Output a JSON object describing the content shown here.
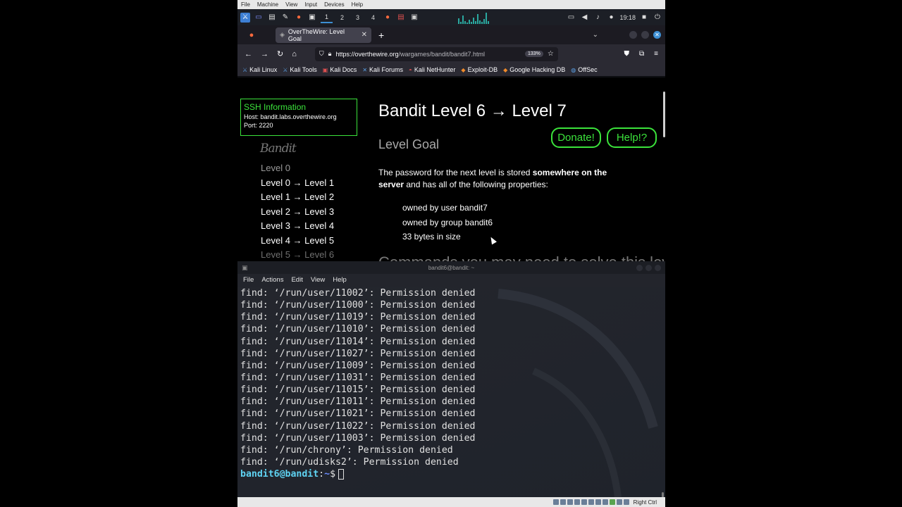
{
  "vbox_menu": [
    "File",
    "Machine",
    "View",
    "Input",
    "Devices",
    "Help"
  ],
  "panel": {
    "workspaces": [
      "1",
      "2",
      "3",
      "4"
    ],
    "clock": "19:18"
  },
  "browser": {
    "tab_title": "OverTheWire: Level Goal",
    "url_host": "https://overthewire.org",
    "url_path": "/wargames/bandit/bandit7.html",
    "zoom": "133%",
    "bookmarks": [
      "Kali Linux",
      "Kali Tools",
      "Kali Docs",
      "Kali Forums",
      "Kali NetHunter",
      "Exploit-DB",
      "Google Hacking DB",
      "OffSec"
    ]
  },
  "page": {
    "ssh_title": "SSH Information",
    "ssh_host": "Host: bandit.labs.overthewire.org",
    "ssh_port": "Port: 2220",
    "logo_text": "Bandit",
    "levels": [
      "Level 0",
      "Level 0 → Level 1",
      "Level 1 → Level 2",
      "Level 2 → Level 3",
      "Level 3 → Level 4",
      "Level 4 → Level 5",
      "Level 5 → Level 6"
    ],
    "title": "Bandit Level 6 → Level 7",
    "donate_label": "Donate!",
    "help_label": "Help!?",
    "level_goal_heading": "Level Goal",
    "goal_intro": "The password for the next level is stored ",
    "goal_bold": "somewhere on the server",
    "goal_rest": " and has all of the following properties:",
    "properties": [
      "owned by user bandit7",
      "owned by group bandit6",
      "33 bytes in size"
    ],
    "next_heading_partial": "Commands you may need to solve this level"
  },
  "terminal": {
    "title": "bandit6@bandit: ~",
    "menu": [
      "File",
      "Actions",
      "Edit",
      "View",
      "Help"
    ],
    "lines": [
      "find: ‘/run/user/11002’: Permission denied",
      "find: ‘/run/user/11000’: Permission denied",
      "find: ‘/run/user/11019’: Permission denied",
      "find: ‘/run/user/11010’: Permission denied",
      "find: ‘/run/user/11014’: Permission denied",
      "find: ‘/run/user/11027’: Permission denied",
      "find: ‘/run/user/11009’: Permission denied",
      "find: ‘/run/user/11031’: Permission denied",
      "find: ‘/run/user/11015’: Permission denied",
      "find: ‘/run/user/11011’: Permission denied",
      "find: ‘/run/user/11021’: Permission denied",
      "find: ‘/run/user/11022’: Permission denied",
      "find: ‘/run/user/11003’: Permission denied",
      "find: ‘/run/chrony’: Permission denied",
      "find: ‘/run/udisks2’: Permission denied"
    ],
    "prompt_user": "bandit6@bandit",
    "prompt_sep": ":",
    "prompt_path": "~",
    "prompt_sign": "$"
  },
  "vbox_status": {
    "host_key": "Right Ctrl"
  },
  "colors": {
    "accent_green": "#3be33b",
    "terminal_bg": "#23252c",
    "prompt_cyan": "#5fd3f3",
    "prompt_blue": "#6b8cff"
  }
}
